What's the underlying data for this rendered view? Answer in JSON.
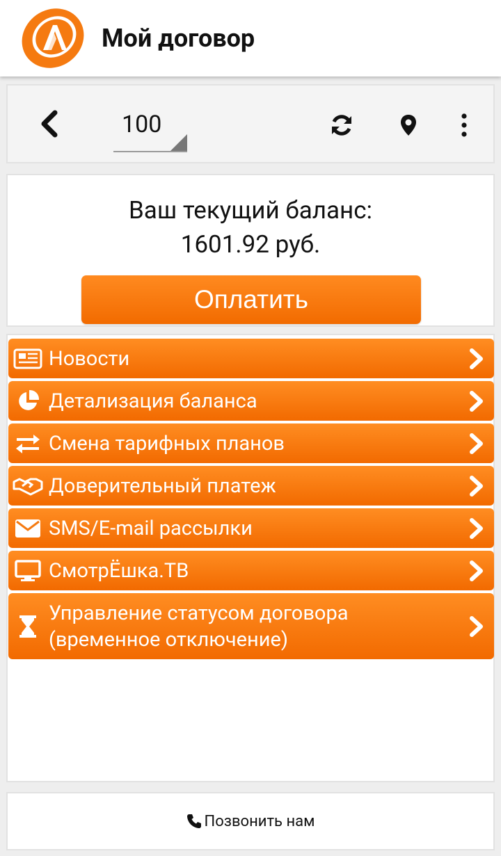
{
  "header": {
    "title": "Мой договор",
    "brand_color": "#ff7a0d"
  },
  "toolbar": {
    "contract_selected": "100",
    "icons": [
      "back-icon",
      "refresh-icon",
      "location-pin-icon",
      "more-vert-icon"
    ]
  },
  "balance": {
    "label": "Ваш текущий баланс:",
    "value": "1601.92 руб.",
    "pay_label": "Оплатить"
  },
  "menu": {
    "items": [
      {
        "label": "Новости",
        "icon": "newspaper-icon"
      },
      {
        "label": "Детализация баланса",
        "icon": "pie-chart-icon"
      },
      {
        "label": "Смена тарифных планов",
        "icon": "exchange-icon"
      },
      {
        "label": "Доверительный платеж",
        "icon": "handshake-icon"
      },
      {
        "label": "SMS/E-mail рассылки",
        "icon": "envelope-icon"
      },
      {
        "label": "СмотрЁшка.ТВ",
        "icon": "monitor-icon"
      },
      {
        "label": "Управление статусом договора",
        "label2": "(временное отключение)",
        "icon": "hourglass-icon"
      }
    ],
    "accent_color": "#f57200"
  },
  "footer": {
    "call_label": "Позвонить нам"
  }
}
